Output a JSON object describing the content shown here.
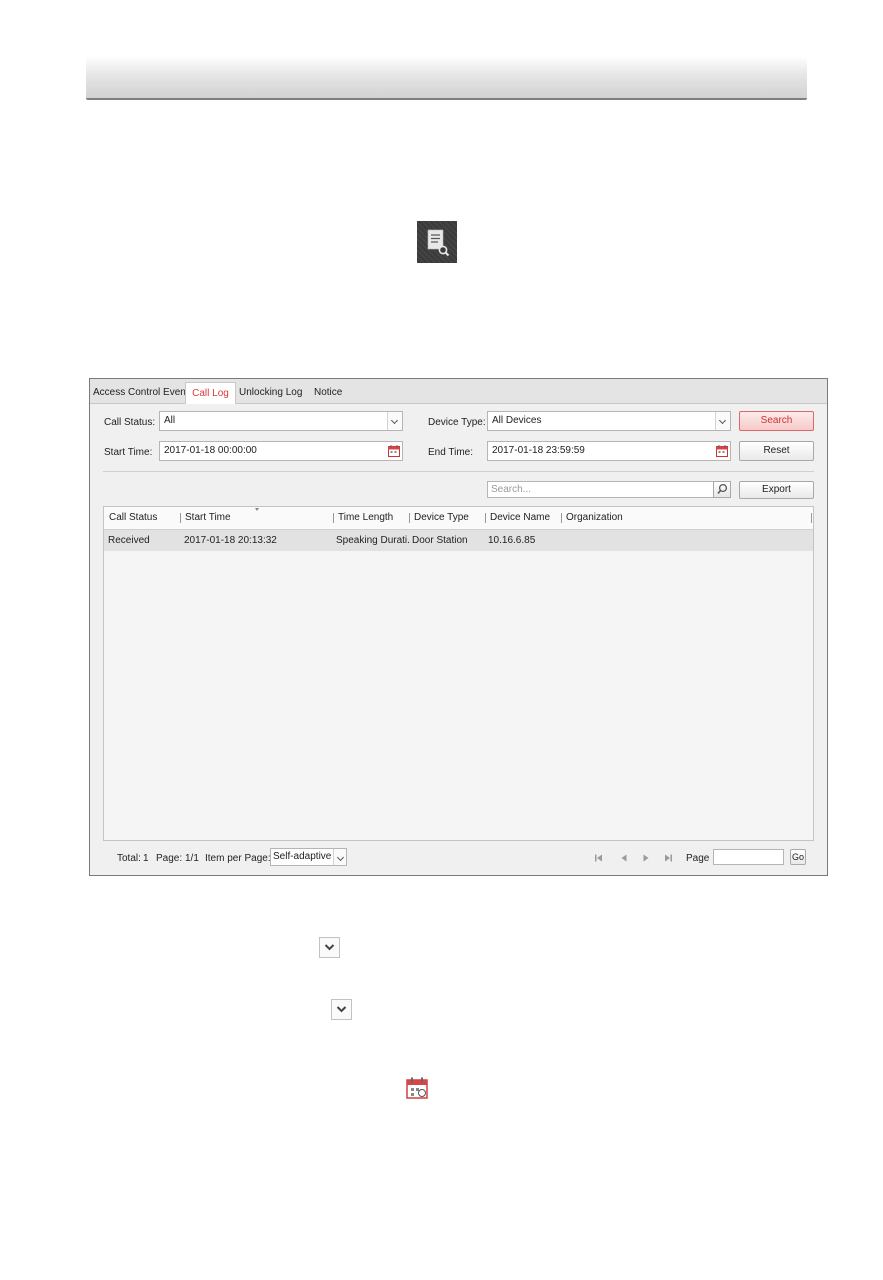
{
  "tabs": [
    {
      "label": "Access Control Event"
    },
    {
      "label": "Call Log"
    },
    {
      "label": "Unlocking Log"
    },
    {
      "label": "Notice"
    }
  ],
  "filters": {
    "call_status_label": "Call Status:",
    "call_status_value": "All",
    "device_type_label": "Device Type:",
    "device_type_value": "All Devices",
    "start_time_label": "Start Time:",
    "start_time_value": "2017-01-18 00:00:00",
    "end_time_label": "End Time:",
    "end_time_value": "2017-01-18 23:59:59",
    "search_button": "Search",
    "reset_button": "Reset"
  },
  "toolbar": {
    "search_placeholder": "Search...",
    "export_button": "Export"
  },
  "table": {
    "columns": [
      "Call Status",
      "Start Time",
      "Time Length",
      "Device Type",
      "Device Name",
      "Organization"
    ],
    "rows": [
      [
        "Received",
        "2017-01-18 20:13:32",
        "Speaking Durati...",
        "Door Station",
        "10.16.6.85",
        ""
      ]
    ]
  },
  "footer": {
    "total_label": "Total:",
    "total_value": "1",
    "page_label": "Page:",
    "page_value": "1/1",
    "item_per_page_label": "Item per Page:",
    "item_per_page_value": "Self-adaptive",
    "page_jump_label": "Page",
    "go_button": "Go"
  },
  "colors": {
    "accent_red": "#d93838",
    "header_border": "#7f7f7f"
  },
  "icons": [
    "log-search-icon",
    "dropdown-arrow-icon",
    "calendar-icon",
    "magnifier-icon",
    "first-page-icon",
    "prev-page-icon",
    "next-page-icon",
    "last-page-icon"
  ]
}
